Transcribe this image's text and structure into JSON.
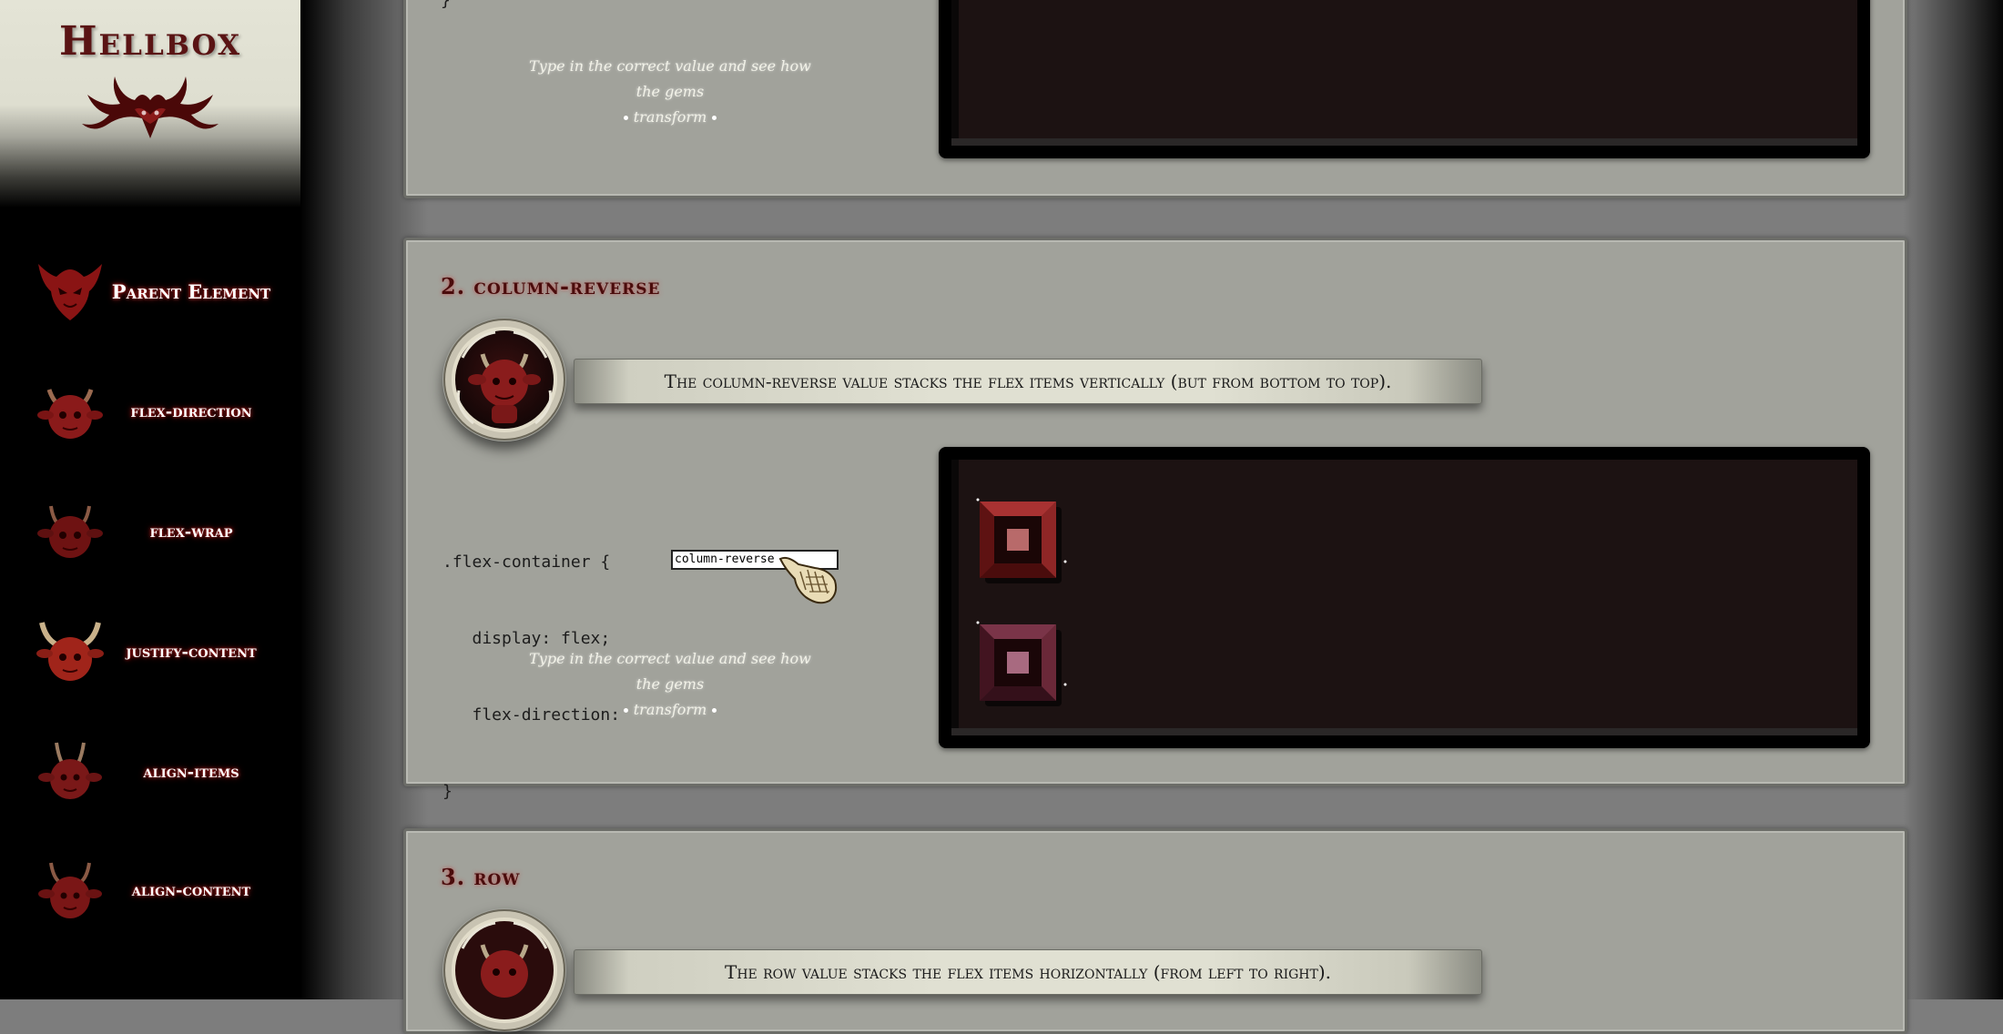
{
  "sidebar": {
    "title": "Hellbox",
    "items": [
      {
        "label": "Parent Element",
        "icon": "demon-mask-icon"
      },
      {
        "label": "flex-direction",
        "icon": "imp-head-icon"
      },
      {
        "label": "flex-wrap",
        "icon": "imp-head-icon"
      },
      {
        "label": "justify-content",
        "icon": "horned-demon-head-icon"
      },
      {
        "label": "align-items",
        "icon": "imp-head-icon"
      },
      {
        "label": "align-content",
        "icon": "imp-head-icon"
      }
    ]
  },
  "hint_text": "Type in the correct value and see how the gems transform",
  "hint_line1": "Type in the correct value and see how the gems",
  "hint_line2": "transform",
  "section1": {
    "code_tail": "}"
  },
  "section2": {
    "title": "2. column-reverse",
    "description": "The column-reverse value stacks the flex items vertically (but from bottom to top).",
    "code_line1": ".flex-container {",
    "code_line2": "   display: flex;",
    "code_line3": "   flex-direction:",
    "code_line4": "}",
    "input_value": "column-reverse"
  },
  "section3": {
    "title": "3. row",
    "description": "The row value stacks the flex items horizontally (from left to right)."
  },
  "colors": {
    "gem_red": "#7a1c1c",
    "gem_purple": "#5a2030",
    "accent_title": "#4a0c0c"
  }
}
